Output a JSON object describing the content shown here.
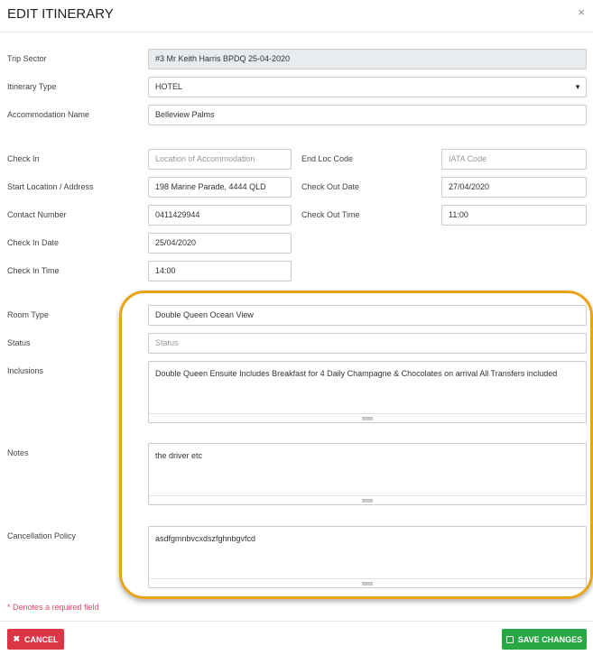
{
  "title": "EDIT ITINERARY",
  "close": "×",
  "fields": {
    "trip_sector": {
      "label": "Trip Sector",
      "value": "#3 Mr Keith Harris BPDQ 25-04-2020"
    },
    "itinerary_type": {
      "label": "Itinerary Type",
      "value": "HOTEL"
    },
    "accommodation_name": {
      "label": "Accommodation Name",
      "value": "Belleview Palms"
    },
    "check_in": {
      "label": "Check In",
      "placeholder": "Location of Accommodation"
    },
    "end_loc_code": {
      "label": "End Loc Code",
      "placeholder": "IATA Code"
    },
    "start_location": {
      "label": "Start Location / Address",
      "value": "198 Marine Parade, 4444 QLD"
    },
    "check_out_date": {
      "label": "Check Out Date",
      "value": "27/04/2020"
    },
    "contact_number": {
      "label": "Contact Number",
      "value": "0411429944"
    },
    "check_out_time": {
      "label": "Check Out Time",
      "value": "11:00"
    },
    "check_in_date": {
      "label": "Check In Date",
      "value": "25/04/2020"
    },
    "check_in_time": {
      "label": "Check In Time",
      "value": "14:00"
    },
    "room_type": {
      "label": "Room Type",
      "value": "Double Queen Ocean View"
    },
    "status": {
      "label": "Status",
      "placeholder": "Status"
    },
    "inclusions": {
      "label": "Inclusions",
      "value": "Double Queen Ensuite Includes Breakfast for 4 Daily Champagne & Chocolates on arrival All Transfers included"
    },
    "notes": {
      "label": "Notes",
      "value": "the driver etc"
    },
    "cancellation": {
      "label": "Cancellation Policy",
      "value": "asdfgmnbvcxdszfghnbgvfcd"
    }
  },
  "required_note": "* Denotes a required field",
  "buttons": {
    "cancel": "CANCEL",
    "save": "SAVE CHANGES"
  },
  "colors": {
    "cancel": "#dc3545",
    "save": "#28a745",
    "highlight": "#e8a317"
  }
}
